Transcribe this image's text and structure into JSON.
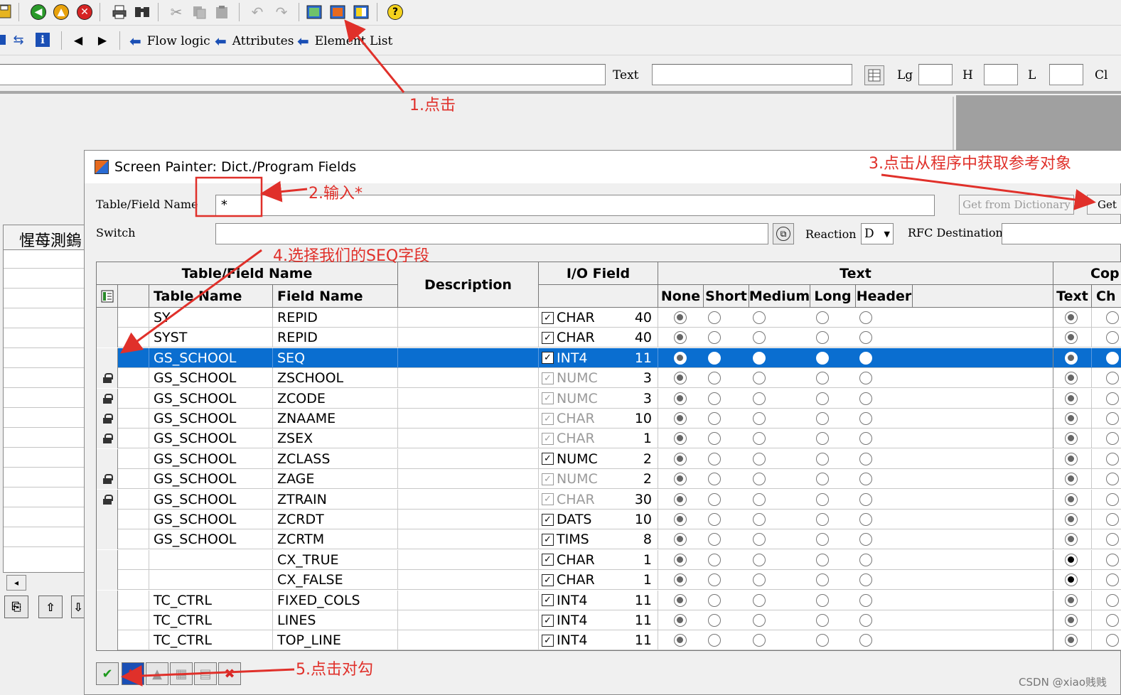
{
  "toolbar_top": {
    "icons": [
      "save-icon",
      "back-icon",
      "exit-icon",
      "cancel-icon",
      "print-icon",
      "find-icon",
      "cut-icon",
      "copy-icon",
      "paste-icon",
      "undo-icon",
      "redo-icon",
      "layout-icon",
      "dict-program-fields-icon",
      "graphics-icon",
      "help-icon"
    ]
  },
  "toolbar_nav": {
    "flow_logic": "Flow logic",
    "attributes": "Attributes",
    "element_list": "Element List"
  },
  "attr_bar": {
    "text_label": "Text",
    "lg_label": "Lg",
    "h_label": "H",
    "l_label": "L",
    "cl_label": "Cl"
  },
  "left_panel": {
    "header": "惺苺測鎢"
  },
  "dialog": {
    "title": "Screen Painter: Dict./Program Fields",
    "table_field_label": "Table/Field Name",
    "table_field_value": "*",
    "get_from_dictionary": "Get from Dictionary",
    "get_from_program": "Get",
    "switch_label": "Switch",
    "reaction_label": "Reaction",
    "reaction_value": "D",
    "rfc_label": "RFC Destination"
  },
  "grid": {
    "group_headers": {
      "table_field_name": "Table/Field Name",
      "description": "Description",
      "io_field": "I/O Field",
      "text": "Text",
      "copy": "Cop"
    },
    "col_headers": {
      "table_name": "Table Name",
      "field_name": "Field Name",
      "none": "None",
      "short": "Short",
      "medium": "Medium",
      "long": "Long",
      "header": "Header",
      "copy_text": "Text",
      "copy_ch": "Ch"
    },
    "rows": [
      {
        "table": "SY",
        "field": "REPID",
        "type": "CHAR",
        "len": "40",
        "checked": true,
        "enabled": true,
        "locked": false,
        "selected": false,
        "copy_dark": false
      },
      {
        "table": "SYST",
        "field": "REPID",
        "type": "CHAR",
        "len": "40",
        "checked": true,
        "enabled": true,
        "locked": false,
        "selected": false,
        "copy_dark": false
      },
      {
        "table": "GS_SCHOOL",
        "field": "SEQ",
        "type": "INT4",
        "len": "11",
        "checked": true,
        "enabled": true,
        "locked": false,
        "selected": true,
        "copy_dark": false
      },
      {
        "table": "GS_SCHOOL",
        "field": "ZSCHOOL",
        "type": "NUMC",
        "len": "3",
        "checked": true,
        "enabled": false,
        "locked": true,
        "selected": false,
        "copy_dark": false
      },
      {
        "table": "GS_SCHOOL",
        "field": "ZCODE",
        "type": "NUMC",
        "len": "3",
        "checked": true,
        "enabled": false,
        "locked": true,
        "selected": false,
        "copy_dark": false
      },
      {
        "table": "GS_SCHOOL",
        "field": "ZNAAME",
        "type": "CHAR",
        "len": "10",
        "checked": true,
        "enabled": false,
        "locked": true,
        "selected": false,
        "copy_dark": false
      },
      {
        "table": "GS_SCHOOL",
        "field": "ZSEX",
        "type": "CHAR",
        "len": "1",
        "checked": true,
        "enabled": false,
        "locked": true,
        "selected": false,
        "copy_dark": false
      },
      {
        "table": "GS_SCHOOL",
        "field": "ZCLASS",
        "type": "NUMC",
        "len": "2",
        "checked": true,
        "enabled": true,
        "locked": false,
        "selected": false,
        "copy_dark": false
      },
      {
        "table": "GS_SCHOOL",
        "field": "ZAGE",
        "type": "NUMC",
        "len": "2",
        "checked": true,
        "enabled": false,
        "locked": true,
        "selected": false,
        "copy_dark": false
      },
      {
        "table": "GS_SCHOOL",
        "field": "ZTRAIN",
        "type": "CHAR",
        "len": "30",
        "checked": true,
        "enabled": false,
        "locked": true,
        "selected": false,
        "copy_dark": false
      },
      {
        "table": "GS_SCHOOL",
        "field": "ZCRDT",
        "type": "DATS",
        "len": "10",
        "checked": true,
        "enabled": true,
        "locked": false,
        "selected": false,
        "copy_dark": false
      },
      {
        "table": "GS_SCHOOL",
        "field": "ZCRTM",
        "type": "TIMS",
        "len": "8",
        "checked": true,
        "enabled": true,
        "locked": false,
        "selected": false,
        "copy_dark": false
      },
      {
        "table": "",
        "field": "CX_TRUE",
        "type": "CHAR",
        "len": "1",
        "checked": true,
        "enabled": true,
        "locked": false,
        "selected": false,
        "copy_dark": true
      },
      {
        "table": "",
        "field": "CX_FALSE",
        "type": "CHAR",
        "len": "1",
        "checked": true,
        "enabled": true,
        "locked": false,
        "selected": false,
        "copy_dark": true
      },
      {
        "table": "TC_CTRL",
        "field": "FIXED_COLS",
        "type": "INT4",
        "len": "11",
        "checked": true,
        "enabled": true,
        "locked": false,
        "selected": false,
        "copy_dark": false
      },
      {
        "table": "TC_CTRL",
        "field": "LINES",
        "type": "INT4",
        "len": "11",
        "checked": true,
        "enabled": true,
        "locked": false,
        "selected": false,
        "copy_dark": false
      },
      {
        "table": "TC_CTRL",
        "field": "TOP_LINE",
        "type": "INT4",
        "len": "11",
        "checked": true,
        "enabled": true,
        "locked": false,
        "selected": false,
        "copy_dark": false
      }
    ]
  },
  "annotations": {
    "a1": "1.点击",
    "a2": "2.输入*",
    "a3": "3.点击从程序中获取参考对象",
    "a4": "4.选择我们的SEQ字段",
    "a5": "5.点击对勾"
  },
  "watermark": "CSDN @xiao贱贱"
}
